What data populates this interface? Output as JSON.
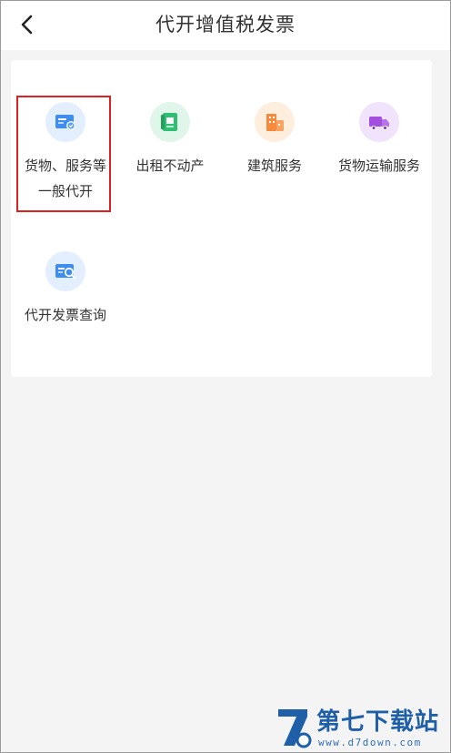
{
  "header": {
    "title": "代开增值税发票"
  },
  "services": [
    {
      "label": "货物、服务等一般代开",
      "icon": "invoice-card-icon",
      "color": "#3d8ef0",
      "bg": "#e3efff"
    },
    {
      "label": "出租不动产",
      "icon": "property-book-icon",
      "color": "#2fbf71",
      "bg": "#e0f6ea"
    },
    {
      "label": "建筑服务",
      "icon": "building-icon",
      "color": "#f58a3c",
      "bg": "#fdeedd"
    },
    {
      "label": "货物运输服务",
      "icon": "truck-icon",
      "color": "#a24fe0",
      "bg": "#f1e3fb"
    },
    {
      "label": "代开发票查询",
      "icon": "invoice-search-icon",
      "color": "#3d8ef0",
      "bg": "#e3efff"
    }
  ],
  "watermark": {
    "title": "第七下载站",
    "url": "www.d7down.com"
  }
}
